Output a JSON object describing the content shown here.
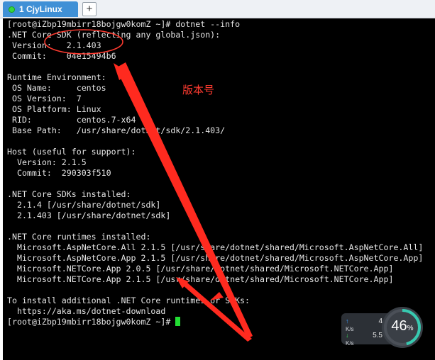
{
  "tabbar": {
    "tab": {
      "label": "1 CjyLinux",
      "status_color": "#35d63e"
    },
    "add_label": "+"
  },
  "terminal": {
    "lines": [
      "[root@iZbp19mbirr18bojgw0komZ ~]# dotnet --info",
      ".NET Core SDK (reflecting any global.json):",
      " Version:   2.1.403",
      " Commit:    04e15494b6",
      "",
      "Runtime Environment:",
      " OS Name:     centos",
      " OS Version:  7",
      " OS Platform: Linux",
      " RID:         centos.7-x64",
      " Base Path:   /usr/share/dotnet/sdk/2.1.403/",
      "",
      "Host (useful for support):",
      "  Version: 2.1.5",
      "  Commit:  290303f510",
      "",
      ".NET Core SDKs installed:",
      "  2.1.4 [/usr/share/dotnet/sdk]",
      "  2.1.403 [/usr/share/dotnet/sdk]",
      "",
      ".NET Core runtimes installed:",
      "  Microsoft.AspNetCore.All 2.1.5 [/usr/share/dotnet/shared/Microsoft.AspNetCore.All]",
      "  Microsoft.AspNetCore.App 2.1.5 [/usr/share/dotnet/shared/Microsoft.AspNetCore.App]",
      "  Microsoft.NETCore.App 2.0.5 [/usr/share/dotnet/shared/Microsoft.NETCore.App]",
      "  Microsoft.NETCore.App 2.1.5 [/usr/share/dotnet/shared/Microsoft.NETCore.App]",
      "",
      "To install additional .NET Core runtimes or SDKs:",
      "  https://aka.ms/dotnet-download"
    ],
    "prompt": "[root@iZbp19mbirr18bojgw0komZ ~]# ",
    "cursor_color": "#22dd33"
  },
  "annotation": {
    "text": "版本号",
    "color": "#ff3b30"
  },
  "net_widget": {
    "upload": "4",
    "upload_unit": "K/s",
    "download": "5.5",
    "download_unit": "K/s",
    "usage_percent": "46",
    "usage_symbol": "%",
    "usage_value": 0.46
  }
}
